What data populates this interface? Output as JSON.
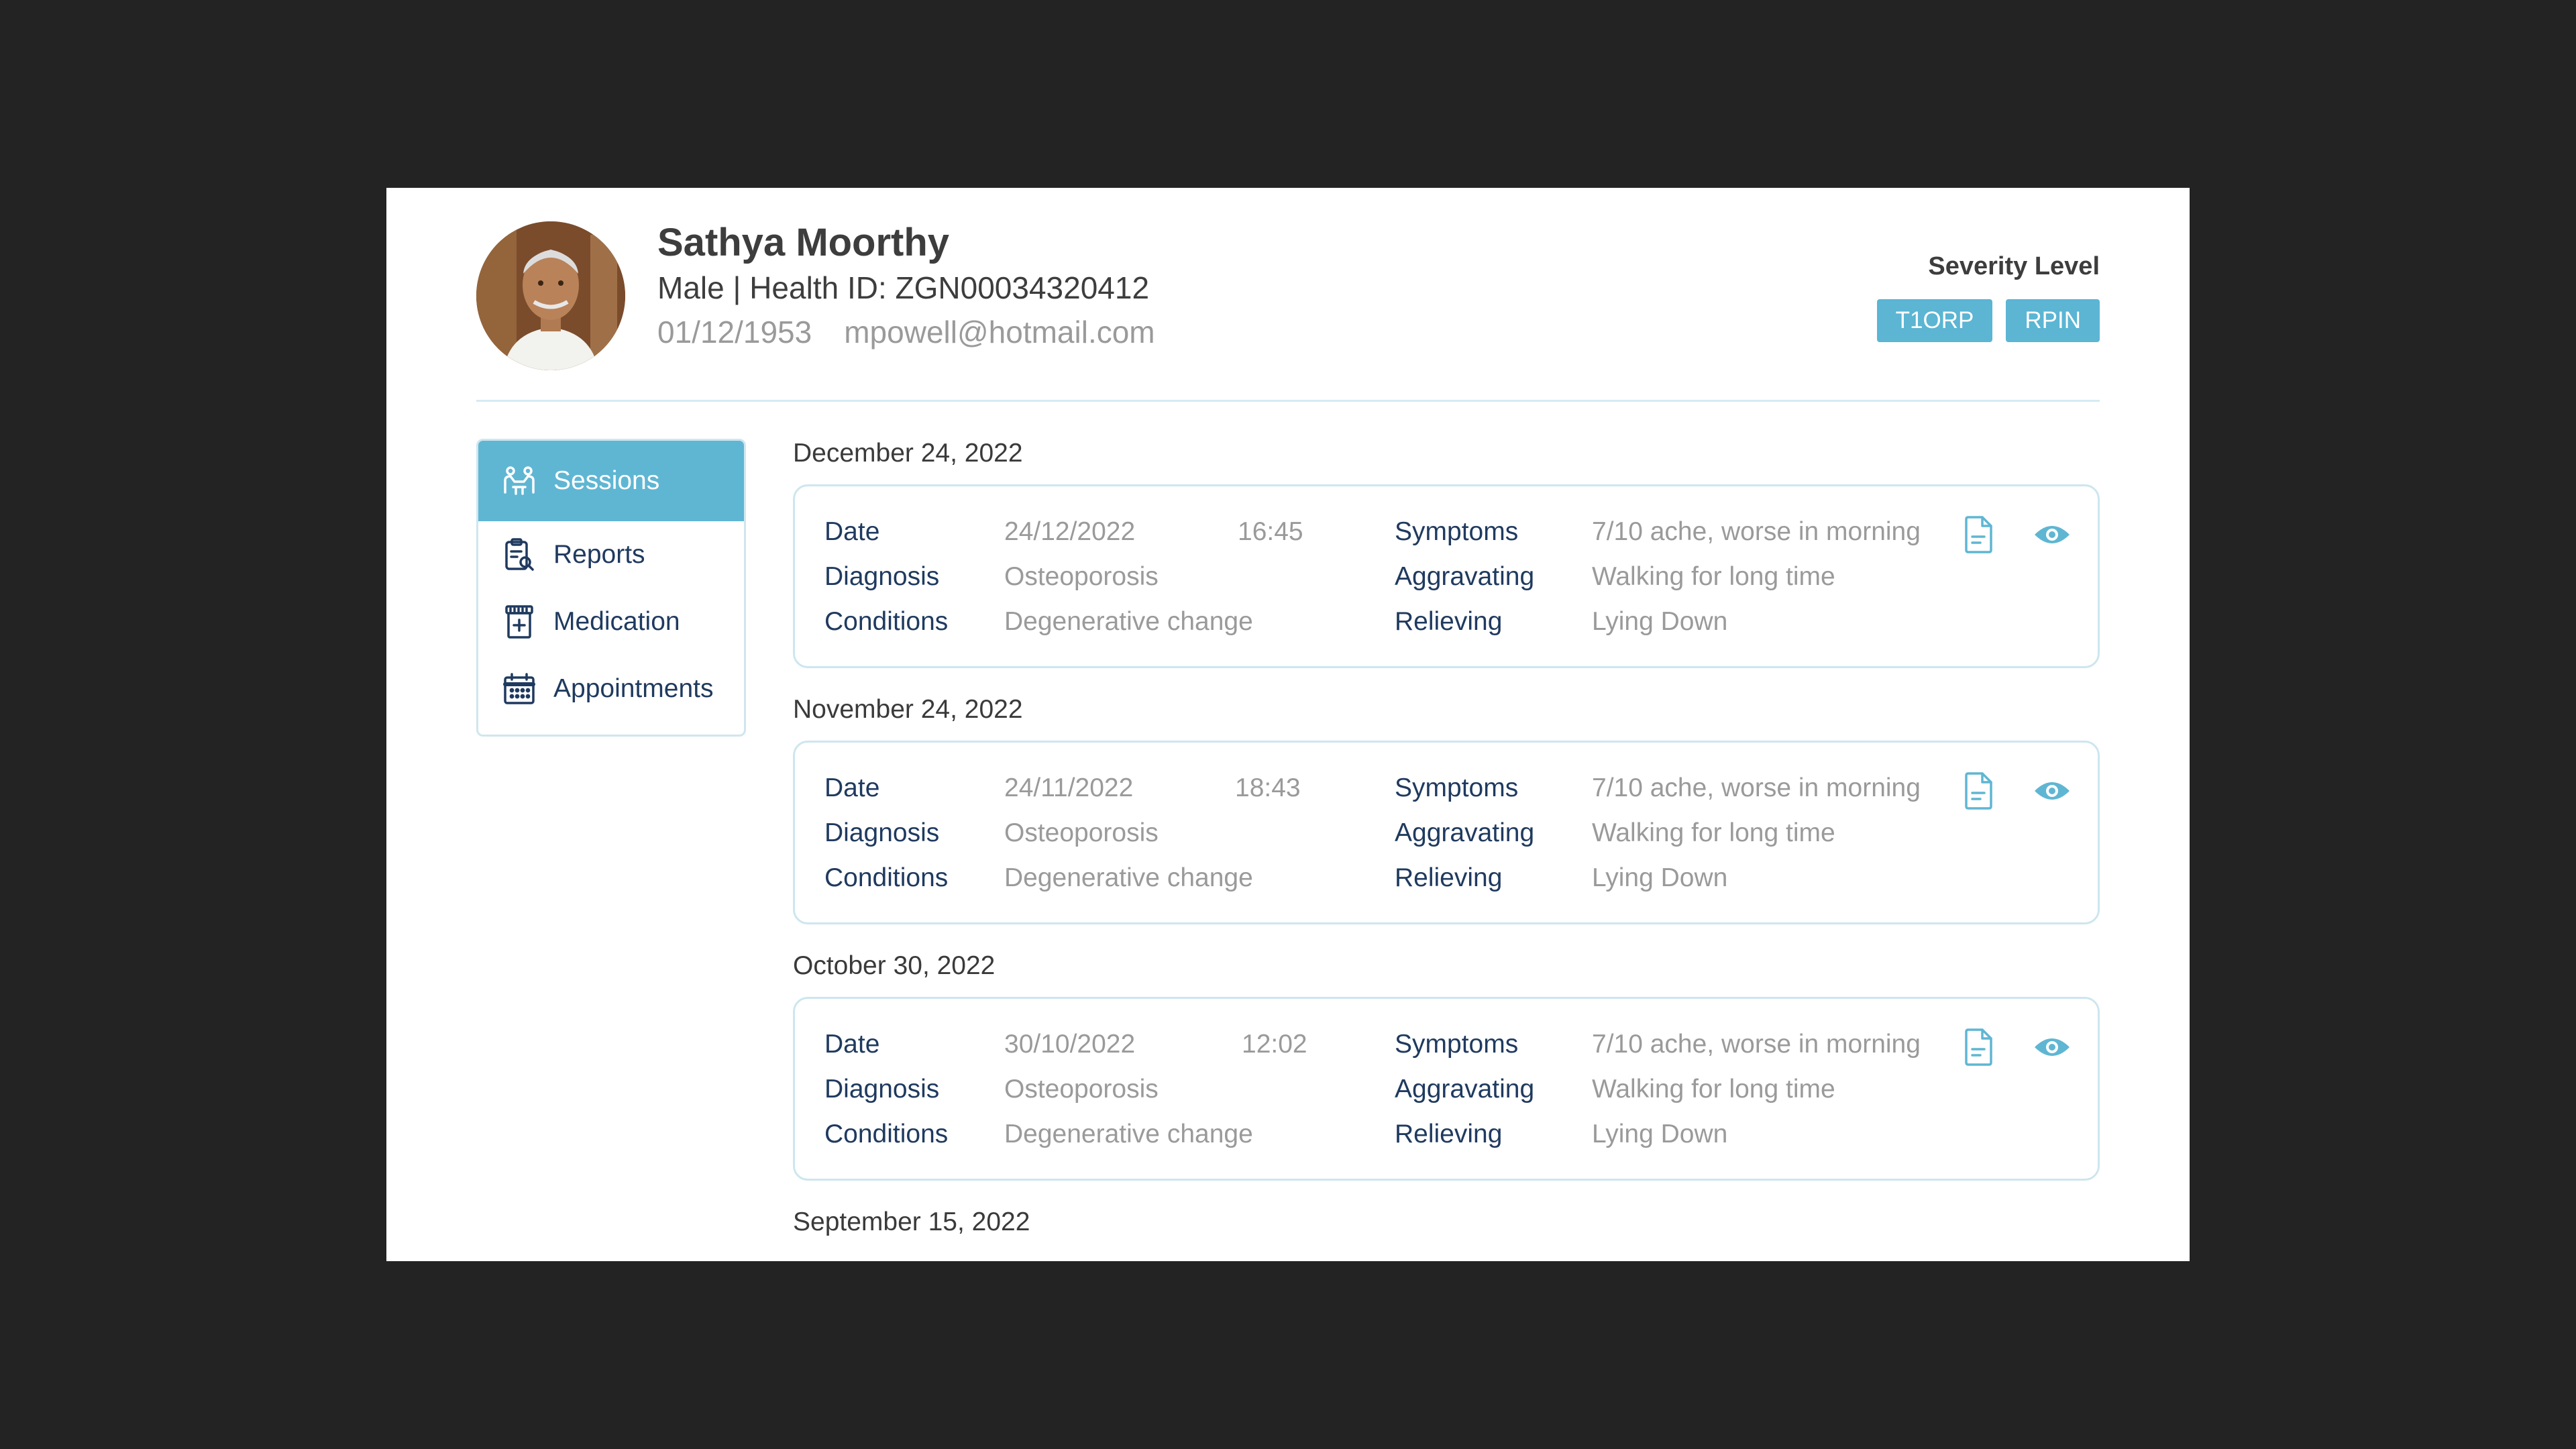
{
  "patient": {
    "name": "Sathya Moorthy",
    "gender_id_line": "Male | Health ID: ZGN00034320412",
    "dob": "01/12/1953",
    "email": "mpowell@hotmail.com",
    "avatar_icon": "patient-photo"
  },
  "severity": {
    "label": "Severity Level",
    "badges": [
      "T1ORP",
      "RPIN"
    ],
    "badge_color": "#5bb5d3"
  },
  "sidebar": {
    "items": [
      {
        "label": "Sessions",
        "icon": "sessions-icon",
        "active": true
      },
      {
        "label": "Reports",
        "icon": "reports-icon",
        "active": false
      },
      {
        "label": "Medication",
        "icon": "medication-icon",
        "active": false
      },
      {
        "label": "Appointments",
        "icon": "calendar-icon",
        "active": false
      }
    ]
  },
  "field_labels": {
    "date": "Date",
    "diagnosis": "Diagnosis",
    "conditions": "Conditions",
    "symptoms": "Symptoms",
    "aggravating": "Aggravating",
    "relieving": "Relieving"
  },
  "sessions": [
    {
      "heading": "December 24, 2022",
      "date": "24/12/2022",
      "time": "16:45",
      "diagnosis": "Osteoporosis",
      "conditions": "Degenerative change",
      "symptoms": "7/10 ache, worse in morning",
      "aggravating": "Walking for long time",
      "relieving": "Lying Down"
    },
    {
      "heading": "November 24, 2022",
      "date": "24/11/2022",
      "time": "18:43",
      "diagnosis": "Osteoporosis",
      "conditions": "Degenerative change",
      "symptoms": "7/10 ache, worse in morning",
      "aggravating": "Walking for long time",
      "relieving": "Lying Down"
    },
    {
      "heading": "October 30, 2022",
      "date": "30/10/2022",
      "time": "12:02",
      "diagnosis": "Osteoporosis",
      "conditions": "Degenerative change",
      "symptoms": "7/10 ache, worse in morning",
      "aggravating": "Walking for long time",
      "relieving": "Lying Down"
    }
  ],
  "next_heading": "September 15, 2022",
  "colors": {
    "accent": "#5fb6d3",
    "label_navy": "#1f3a5f",
    "value_gray": "#9a9a9a",
    "card_border": "#cde6ef",
    "backdrop": "#232323"
  }
}
